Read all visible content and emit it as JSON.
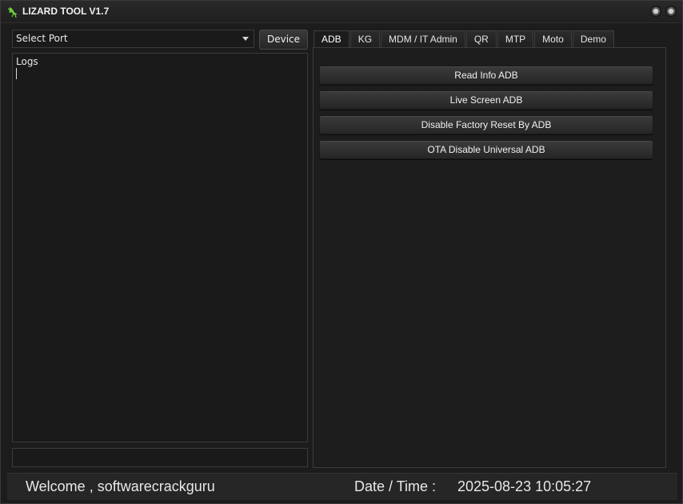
{
  "window": {
    "title": "LIZARD TOOL V1.7",
    "icon": "lizard-icon"
  },
  "port": {
    "selected": "Select Port"
  },
  "device_button": "Device",
  "logs": {
    "label": "Logs"
  },
  "progress": {
    "value": 0
  },
  "tabs": [
    {
      "label": "ADB",
      "active": true
    },
    {
      "label": "KG",
      "active": false
    },
    {
      "label": "MDM / IT Admin",
      "active": false
    },
    {
      "label": "QR",
      "active": false
    },
    {
      "label": "MTP",
      "active": false
    },
    {
      "label": "Moto",
      "active": false
    },
    {
      "label": "Demo",
      "active": false
    }
  ],
  "adb_actions": [
    "Read Info ADB",
    "Live Screen ADB",
    "Disable Factory Reset By ADB",
    "OTA Disable Universal ADB"
  ],
  "status": {
    "welcome": "Welcome , softwarecrackguru",
    "datetime_label": "Date / Time :",
    "datetime_value": "2025-08-23 10:05:27"
  },
  "colors": {
    "background": "#1c1c1c",
    "accent": "#6fcf3a"
  }
}
